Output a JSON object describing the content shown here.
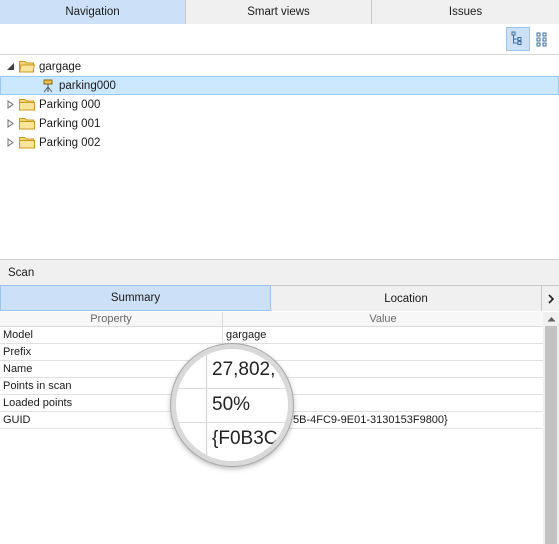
{
  "top_tabs": [
    {
      "label": "Navigation",
      "active": true
    },
    {
      "label": "Smart views",
      "active": false
    },
    {
      "label": "Issues",
      "active": false
    }
  ],
  "toolbar": {
    "buttons": [
      {
        "icon": "tree-view-icon",
        "active": true
      },
      {
        "icon": "grid-view-icon",
        "active": false
      }
    ]
  },
  "tree": [
    {
      "label": "gargage",
      "level": 0,
      "expanded": true,
      "kind": "folder"
    },
    {
      "label": "parking000",
      "level": 1,
      "kind": "scan",
      "selected": true
    },
    {
      "label": "Parking 000",
      "level": 0,
      "expanded": false,
      "kind": "folder"
    },
    {
      "label": "Parking 001",
      "level": 0,
      "expanded": false,
      "kind": "folder"
    },
    {
      "label": "Parking 002",
      "level": 0,
      "expanded": false,
      "kind": "folder"
    }
  ],
  "section": {
    "title": "Scan"
  },
  "bottom_tabs": [
    {
      "label": "Summary",
      "active": true
    },
    {
      "label": "Location",
      "active": false
    }
  ],
  "grid": {
    "headers": {
      "property": "Property",
      "value": "Value"
    },
    "rows": [
      {
        "key": "Model",
        "value": "gargage"
      },
      {
        "key": "Prefix",
        "value": ""
      },
      {
        "key": "Name",
        "value": ""
      },
      {
        "key": "Points in scan",
        "value": ""
      },
      {
        "key": "Loaded points",
        "value": ""
      },
      {
        "key": "GUID",
        "value": "5B-4FC9-9E01-3130153F9800}"
      }
    ]
  },
  "magnifier": {
    "lines": [
      "27,802,",
      "50%",
      "{F0B3C"
    ]
  },
  "colors": {
    "active_tab": "#cce1f7",
    "selection": "#cce8ff",
    "folder": "#f2c84b"
  }
}
